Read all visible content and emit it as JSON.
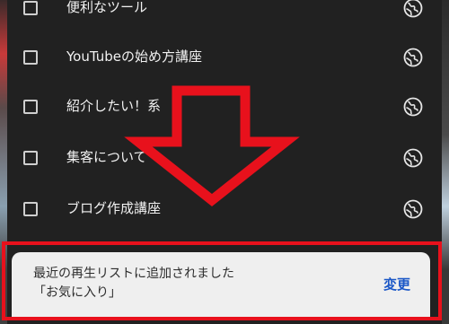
{
  "playlist_items": [
    {
      "label": "便利なツール"
    },
    {
      "label": "YouTubeの始め方講座"
    },
    {
      "label": "紹介したい！系"
    },
    {
      "label": "集客について"
    },
    {
      "label": "ブログ作成講座"
    }
  ],
  "item_visibility_icon": "globe-public-icon",
  "annotation": {
    "arrow_color": "#e8111c",
    "highlight_color": "#e8111c"
  },
  "toast": {
    "line1": "最近の再生リストに追加されました",
    "line2": "「お気に入り」",
    "action_label": "変更"
  }
}
